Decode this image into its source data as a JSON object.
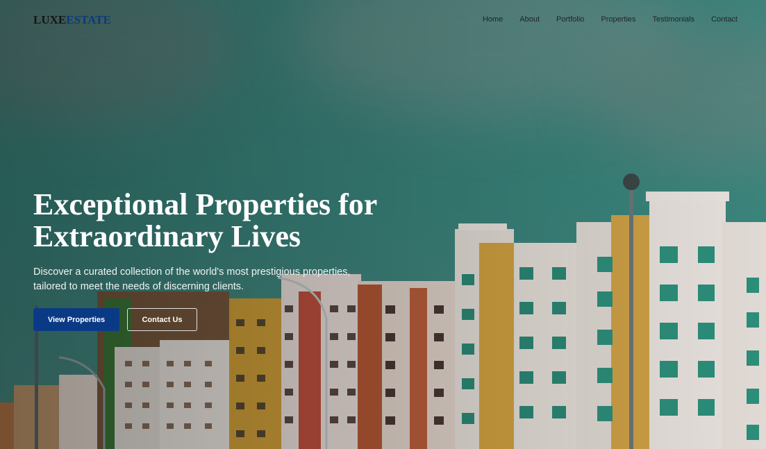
{
  "brand": {
    "part1": "LUXE",
    "part2": "ESTATE"
  },
  "nav": {
    "items": [
      "Home",
      "About",
      "Portfolio",
      "Properties",
      "Testimonials",
      "Contact"
    ]
  },
  "hero": {
    "title_line1": "Exceptional Properties for",
    "title_line2": "Extraordinary Lives",
    "subtitle": "Discover a curated collection of the world's most prestigious properties, tailored to meet the needs of discerning clients.",
    "primary_button": "View Properties",
    "secondary_button": "Contact Us"
  },
  "colors": {
    "accent": "#0a3a86",
    "sky": "#3f8a82",
    "logo_secondary": "#0b3a7a"
  }
}
